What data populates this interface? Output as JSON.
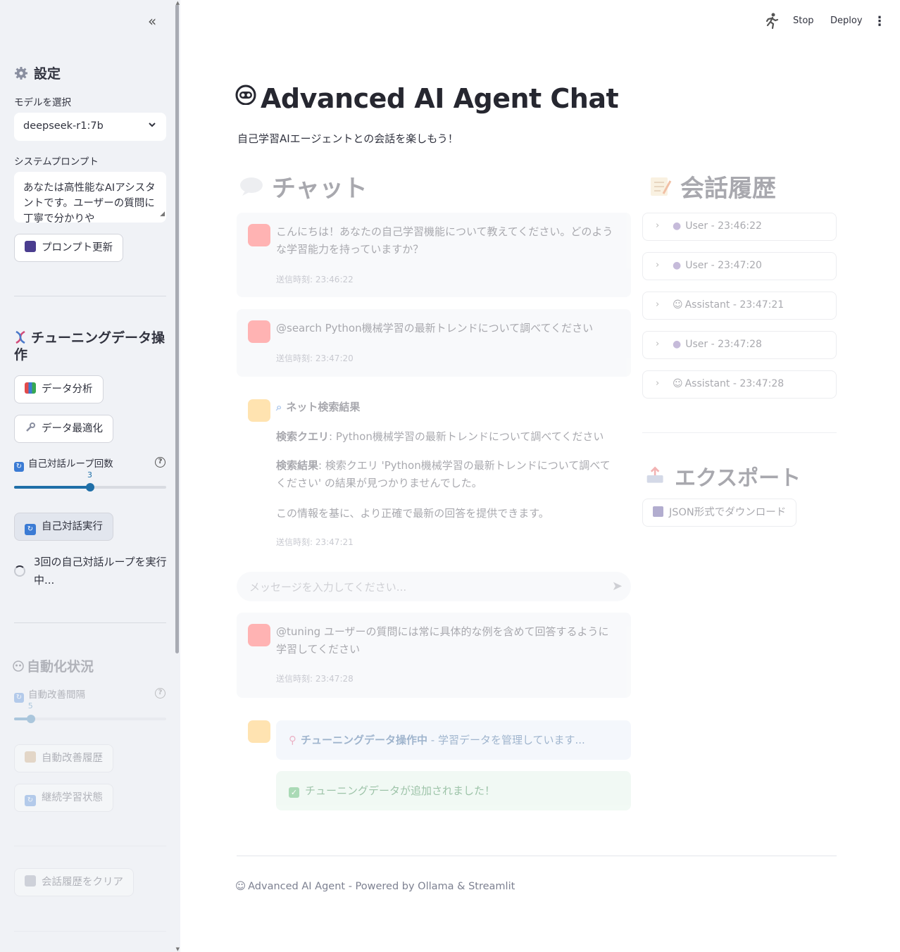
{
  "topbar": {
    "stop_label": "Stop",
    "deploy_label": "Deploy",
    "icons": [
      "running-man-icon",
      "kebab-menu-icon"
    ]
  },
  "sidebar": {
    "collapse_icon": "«",
    "settings_title": "設定",
    "model_label": "モデルを選択",
    "model_value": "deepseek-r1:7b",
    "system_prompt_label": "システムプロンプト",
    "system_prompt_value": "あなたは高性能なAIアシスタントです。ユーザーの質問に丁寧で分かりや",
    "update_prompt_btn": "プロンプト更新",
    "tuning_title": "チューニングデータ操作",
    "data_analysis_btn": "データ分析",
    "data_optimize_btn": "データ最適化",
    "loop_count_label": "自己対話ループ回数",
    "loop_count_value": "3",
    "loop_count_fraction": 0.5,
    "self_dialog_btn": "自己対話実行",
    "running_status": "3回の自己対話ループを実行中...",
    "automation_title": "自動化状況",
    "auto_interval_label": "自動改善間隔",
    "auto_interval_value": "5",
    "auto_interval_fraction": 0.11,
    "auto_history_btn": "自動改善履歴",
    "continuous_btn": "継続学習状態",
    "clear_btn": "会話履歴をクリア"
  },
  "main": {
    "title": "Advanced AI Agent Chat",
    "subtitle": "自己学習AIエージェントとの会話を楽しもう！",
    "chat_title": "チャット",
    "history_title": "会話履歴",
    "export_title": "エクスポート",
    "export_btn": "JSON形式でダウンロード",
    "input_placeholder": "メッセージを入力してください...",
    "footer": "Advanced AI Agent - Powered by Ollama & Streamlit"
  },
  "messages": [
    {
      "text": "こんにちは！あなたの自己学習機能について教えてください。どのような学習能力を持っていますか？",
      "time": "送信時刻: 23:46:22"
    },
    {
      "text": "@search Python機械学習の最新トレンドについて調べてください",
      "time": "送信時刻: 23:47:20"
    },
    {
      "heading": "ネット検索結果",
      "query_label": "検索クエリ",
      "query_value": ": Python機械学習の最新トレンドについて調べてください",
      "result_label": "検索結果",
      "result_value": ": 検索クエリ 'Python機械学習の最新トレンドについて調べてください' の結果が見つかりませんでした。",
      "note": "この情報を基に、より正確で最新の回答を提供できます。",
      "time": "送信時刻: 23:47:21"
    },
    {
      "text": "@tuning ユーザーの質問には常に具体的な例を含めて回答するように学習してください",
      "time": "送信時刻: 23:47:28"
    },
    {
      "info_bold": "チューニングデータ操作中",
      "info_rest": " - 学習データを管理しています...",
      "success": "チューニングデータが追加されました！"
    }
  ],
  "history": [
    {
      "label": "User - 23:46:22"
    },
    {
      "label": "User - 23:47:20"
    },
    {
      "label": "Assistant - 23:47:21"
    },
    {
      "label": "User - 23:47:28"
    },
    {
      "label": "Assistant - 23:47:28"
    }
  ],
  "colors": {
    "sidebar_bg": "#f0f2f6",
    "accent": "#1f6fa8",
    "user_avatar": "#ff4b4b",
    "bot_avatar": "#ffbd45"
  }
}
